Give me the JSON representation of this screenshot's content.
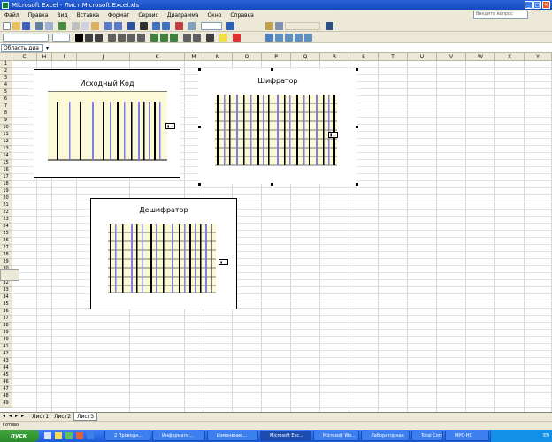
{
  "window": {
    "title": "Microsoft Excel - Лист Microsoft Excel.xls"
  },
  "menu": [
    "Файл",
    "Правка",
    "Вид",
    "Вставка",
    "Формат",
    "Сервис",
    "Диаграмма",
    "Окно",
    "Справка"
  ],
  "help_placeholder": "Введите вопрос",
  "formula_bar": {
    "name_box": "Область диа"
  },
  "columns": [
    "C",
    "H",
    "I",
    "J",
    "K",
    "M",
    "N",
    "O",
    "P",
    "Q",
    "R",
    "S",
    "T",
    "U",
    "V",
    "W",
    "X",
    "Y"
  ],
  "rows": [
    "1",
    "2",
    "3",
    "4",
    "5",
    "6",
    "7",
    "8",
    "9",
    "10",
    "11",
    "12",
    "13",
    "14",
    "15",
    "16",
    "17",
    "18",
    "19",
    "20",
    "21",
    "22",
    "23",
    "24",
    "25",
    "26",
    "27",
    "28",
    "29",
    "30",
    "31",
    "32",
    "33",
    "34",
    "35",
    "36",
    "37",
    "38",
    "39",
    "40",
    "41",
    "42",
    "43",
    "44",
    "45",
    "46",
    "47",
    "48",
    "49"
  ],
  "charts": [
    {
      "title": "Исходный Код"
    },
    {
      "title": "Шифратор"
    },
    {
      "title": "Дешифратор"
    }
  ],
  "sheet_tabs": [
    "Лист1",
    "Лист2",
    "Лист3"
  ],
  "status": "Готово",
  "taskbar": {
    "start": "пуск",
    "tasks": [
      "2 Проводн...",
      "Информати...",
      "Изменение...",
      "Microsoft Exc...",
      "Microsoft Wo...",
      "Лабораторная",
      "Total Comm...",
      "MPC-HC"
    ],
    "tray_lang": "EN"
  }
}
